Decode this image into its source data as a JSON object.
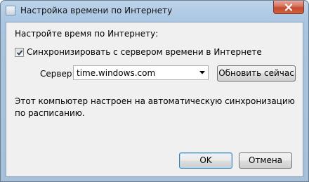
{
  "window": {
    "title": "Настройка времени по Интернету",
    "close_icon": "close-icon"
  },
  "dialog": {
    "heading": "Настройте время по Интернету:",
    "sync_checkbox": {
      "label": "Синхронизировать с сервером времени в Интернете",
      "checked": true
    },
    "server_label": "Сервер:",
    "server_value": "time.windows.com",
    "update_button": "Обновить сейчас",
    "info_text": "Этот компьютер настроен на автоматическую синхронизацию по расписанию.",
    "ok_button": "OK",
    "cancel_button": "Отмена"
  }
}
